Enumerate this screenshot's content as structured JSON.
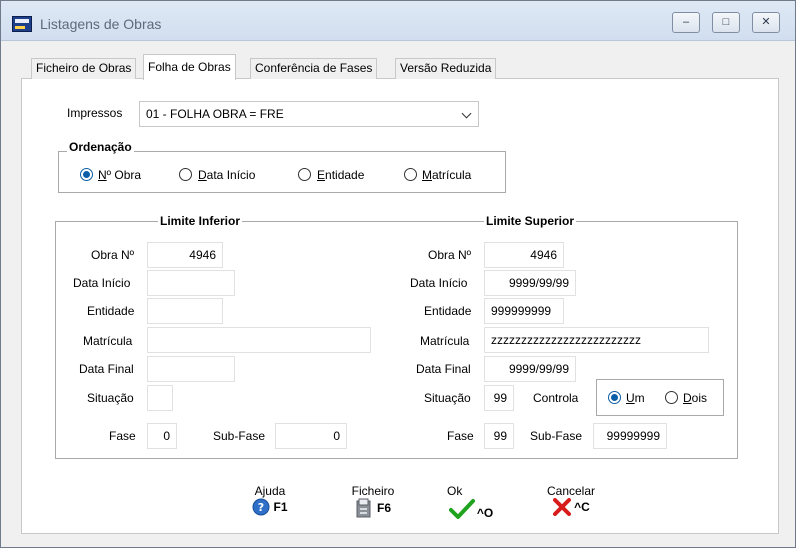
{
  "window": {
    "title": "Listagens de Obras",
    "minimize_glyph": "–",
    "maximize_glyph": "□",
    "close_glyph": "✕"
  },
  "tabs": [
    {
      "label": "Ficheiro de Obras"
    },
    {
      "label": "Folha de Obras"
    },
    {
      "label": "Conferência de Fases"
    },
    {
      "label": "Versão Reduzida"
    }
  ],
  "impressos": {
    "label": "Impressos",
    "value": "01 - FOLHA OBRA = FRE"
  },
  "ordenacao": {
    "title": "Ordenação",
    "options": [
      {
        "label_first": "N",
        "label_rest": "º Obra",
        "selected": true
      },
      {
        "label_first": "D",
        "label_rest": "ata Início",
        "selected": false
      },
      {
        "label_first": "E",
        "label_rest": "ntidade",
        "selected": false
      },
      {
        "label_first": "M",
        "label_rest": "atrícula",
        "selected": false
      }
    ]
  },
  "limits": {
    "inferior": {
      "title": "Limite Inferior",
      "obra_label": "Obra Nº",
      "obra_value": "4946",
      "data_inicio_label": "Data Início",
      "data_inicio_value": "",
      "entidade_label": "Entidade",
      "entidade_value": "",
      "matricula_label": "Matrícula",
      "matricula_value": "",
      "data_final_label": "Data Final",
      "data_final_value": "",
      "situacao_label": "Situação",
      "situacao_value": "",
      "fase_label": "Fase",
      "fase_value": "0",
      "subfase_label": "Sub-Fase",
      "subfase_value": "0"
    },
    "superior": {
      "title": "Limite Superior",
      "obra_label": "Obra Nº",
      "obra_value": "4946",
      "data_inicio_label": "Data Início",
      "data_inicio_value": "9999/99/99",
      "entidade_label": "Entidade",
      "entidade_value": "999999999",
      "matricula_label": "Matrícula",
      "matricula_value": "zzzzzzzzzzzzzzzzzzzzzzzzz",
      "data_final_label": "Data Final",
      "data_final_value": "9999/99/99",
      "situacao_label": "Situação",
      "situacao_value": "99",
      "fase_label": "Fase",
      "fase_value": "99",
      "subfase_label": "Sub-Fase",
      "subfase_value": "99999999"
    }
  },
  "controla": {
    "label": "Controla",
    "options": [
      {
        "label_first": "U",
        "label_rest": "m",
        "selected": true
      },
      {
        "label_first": "D",
        "label_rest": "ois",
        "selected": false
      }
    ]
  },
  "buttons": {
    "ajuda": {
      "label": "Ajuda",
      "key": "F1",
      "icon": "help-icon"
    },
    "ficheiro": {
      "label": "Ficheiro",
      "key": "F6",
      "icon": "file-icon"
    },
    "ok": {
      "label": "Ok",
      "key": "^O",
      "icon": "checkmark-icon"
    },
    "cancelar": {
      "label": "Cancelar",
      "key": "^C",
      "icon": "cross-icon"
    }
  },
  "colors": {
    "accent": "#0b5ea8",
    "ok_green": "#1fa31f",
    "cancel_red": "#d81b1b"
  }
}
